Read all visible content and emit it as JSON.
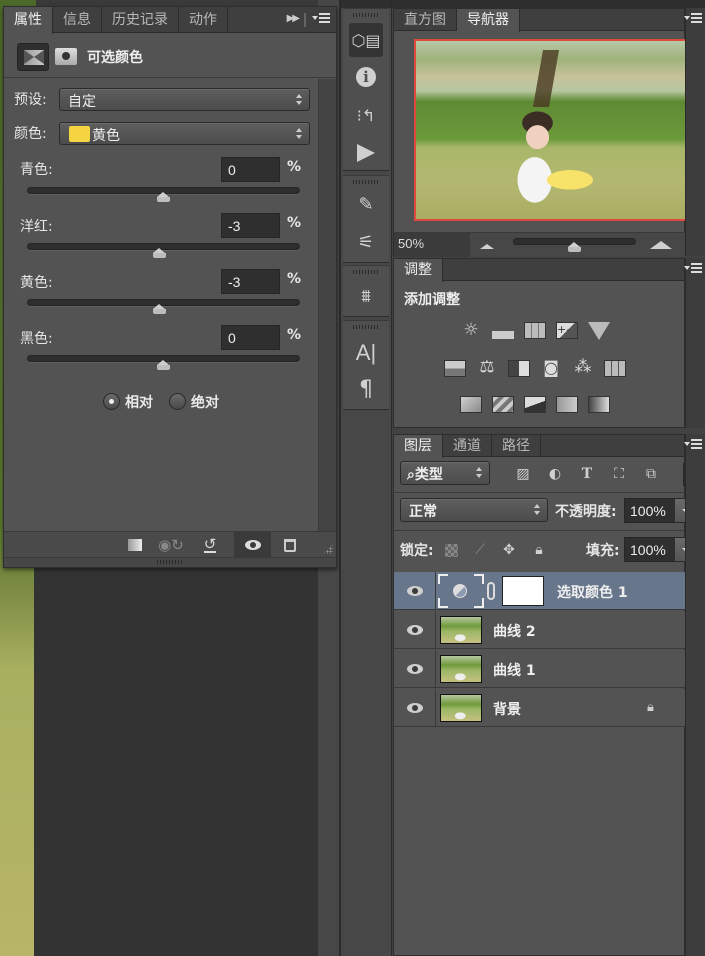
{
  "properties_panel": {
    "tabs": [
      {
        "label": "属性",
        "active": true
      },
      {
        "label": "信息",
        "active": false
      },
      {
        "label": "历史记录",
        "active": false
      },
      {
        "label": "动作",
        "active": false
      }
    ],
    "title": "可选颜色",
    "preset": {
      "label": "预设:",
      "value": "自定"
    },
    "colors": {
      "label": "颜色:",
      "value": "黄色",
      "swatch_color": "#f5d441"
    },
    "sliders": [
      {
        "label": "青色:",
        "value": "0",
        "unit": "%",
        "range": [
          -100,
          100
        ],
        "position": 0
      },
      {
        "label": "洋红:",
        "value": "-3",
        "unit": "%",
        "range": [
          -100,
          100
        ],
        "position": -3
      },
      {
        "label": "黄色:",
        "value": "-3",
        "unit": "%",
        "range": [
          -100,
          100
        ],
        "position": -3
      },
      {
        "label": "黑色:",
        "value": "0",
        "unit": "%",
        "range": [
          -100,
          100
        ],
        "position": 0
      }
    ],
    "method": {
      "options": [
        {
          "label": "相对",
          "checked": true
        },
        {
          "label": "绝对",
          "checked": false
        }
      ]
    },
    "footer_buttons": [
      "clip-to-layer",
      "view-previous-state",
      "reset",
      "toggle-visibility",
      "delete"
    ]
  },
  "mid_toolbar": {
    "groups": [
      {
        "buttons": [
          "properties",
          "info",
          "history",
          "actions"
        ]
      },
      {
        "buttons": [
          "brush-presets",
          "brush"
        ]
      },
      {
        "buttons": [
          "clone-source"
        ]
      },
      {
        "buttons": [
          "character",
          "paragraph"
        ]
      }
    ]
  },
  "navigator_panel": {
    "tabs": [
      {
        "label": "直方图",
        "active": false
      },
      {
        "label": "导航器",
        "active": true
      }
    ],
    "zoom": "50%",
    "zoom_slider_fraction": 0.5,
    "view_box_color": "#e04a3c"
  },
  "adjustments_panel": {
    "tab": "调整",
    "title": "添加调整",
    "rows": [
      [
        "brightness-contrast",
        "levels",
        "curves",
        "exposure",
        "vibrance"
      ],
      [
        "hue-saturation",
        "color-balance",
        "black-white",
        "photo-filter",
        "channel-mixer",
        "color-lookup"
      ],
      [
        "invert",
        "posterize",
        "threshold",
        "selective-color",
        "gradient-map"
      ]
    ]
  },
  "layers_panel": {
    "tabs": [
      {
        "label": "图层",
        "active": true
      },
      {
        "label": "通道",
        "active": false
      },
      {
        "label": "路径",
        "active": false
      }
    ],
    "filter": {
      "label": "类型"
    },
    "blend_mode": "正常",
    "opacity": {
      "label": "不透明度:",
      "value": "100%"
    },
    "lock": {
      "label": "锁定:"
    },
    "fill": {
      "label": "填充:",
      "value": "100%"
    },
    "layers": [
      {
        "name": "选取颜色 1",
        "type": "adjustment",
        "selected": true,
        "visible": true,
        "locked": false
      },
      {
        "name": "曲线 2",
        "type": "image",
        "selected": false,
        "visible": true,
        "locked": false
      },
      {
        "name": "曲线 1",
        "type": "image",
        "selected": false,
        "visible": true,
        "locked": false
      },
      {
        "name": "背景",
        "type": "image",
        "selected": false,
        "visible": true,
        "locked": true
      }
    ]
  }
}
